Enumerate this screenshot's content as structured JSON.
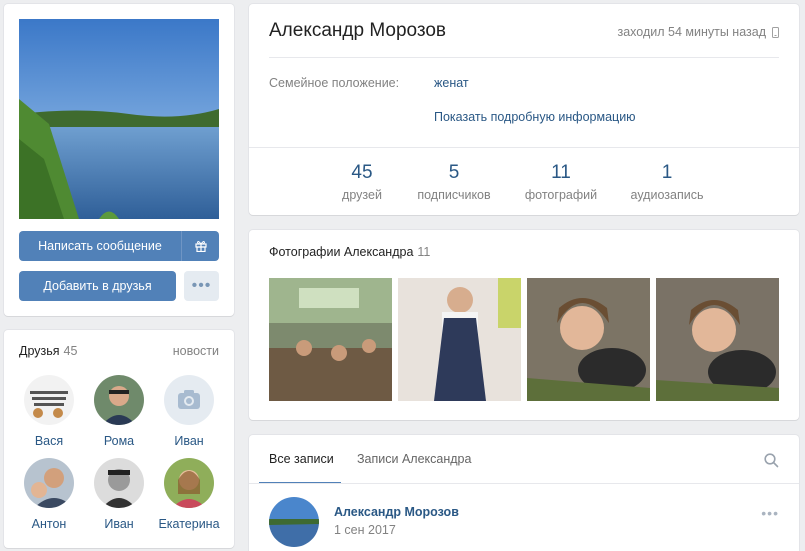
{
  "profile": {
    "name": "Александр Морозов",
    "last_seen": "заходил 54 минуты назад",
    "relationship_label": "Семейное положение:",
    "relationship_value": "женат",
    "more_info": "Показать подробную информацию"
  },
  "actions": {
    "message": "Написать сообщение",
    "add_friend": "Добавить в друзья",
    "more": "•••",
    "gift_icon": "gift-icon"
  },
  "counters": [
    {
      "value": "45",
      "label": "друзей"
    },
    {
      "value": "5",
      "label": "подписчиков"
    },
    {
      "value": "11",
      "label": "фотографий"
    },
    {
      "value": "1",
      "label": "аудиозапись"
    }
  ],
  "friends": {
    "title": "Друзья",
    "count": "45",
    "news": "новости",
    "items": [
      {
        "name": "Вася"
      },
      {
        "name": "Рома"
      },
      {
        "name": "Иван"
      },
      {
        "name": "Антон"
      },
      {
        "name": "Иван"
      },
      {
        "name": "Екатерина"
      }
    ]
  },
  "photos": {
    "title": "Фотографии Александра",
    "count": "11"
  },
  "wall": {
    "tab_all": "Все записи",
    "tab_user": "Записи Александра",
    "post": {
      "author": "Александр Морозов",
      "date": "1 сен 2017",
      "more": "•••"
    }
  },
  "colors": {
    "accent": "#5181b8",
    "link": "#2a5885",
    "background": "#edeef0"
  }
}
